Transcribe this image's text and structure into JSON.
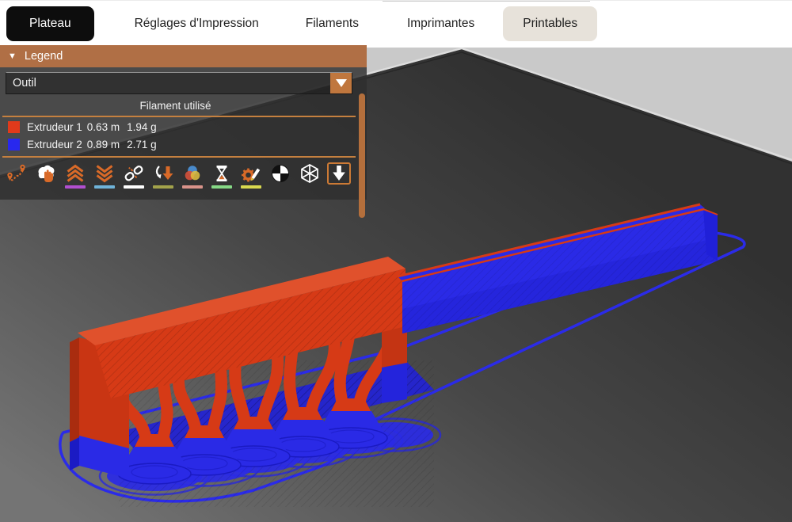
{
  "tabs": {
    "items": [
      {
        "label": "Plateau",
        "state": "active"
      },
      {
        "label": "Réglages d'Impression",
        "state": "normal"
      },
      {
        "label": "Filaments",
        "state": "normal"
      },
      {
        "label": "Imprimantes",
        "state": "normal"
      },
      {
        "label": "Printables",
        "state": "highlighted"
      }
    ]
  },
  "legend": {
    "title": "Legend",
    "collapse_glyph": "▼",
    "view_selector": {
      "value": "Outil"
    },
    "section_header": "Filament utilisé",
    "extruders": [
      {
        "name": "Extrudeur 1",
        "length": "0.63 m",
        "weight": "1.94 g",
        "swatch": "#e13a1b"
      },
      {
        "name": "Extrudeur 2",
        "length": "0.89 m",
        "weight": "2.71 g",
        "swatch": "#2828ee"
      }
    ],
    "toolbar": [
      {
        "name": "travel-paths",
        "underline": null,
        "selected": false
      },
      {
        "name": "wipe",
        "underline": null,
        "selected": false
      },
      {
        "name": "retractions",
        "underline": "#b14fd0",
        "selected": false
      },
      {
        "name": "deretractions",
        "underline": "#6fb3d9",
        "selected": false
      },
      {
        "name": "seams",
        "underline": "#ffffff",
        "selected": false
      },
      {
        "name": "tool-changes",
        "underline": "#a3a34b",
        "selected": false
      },
      {
        "name": "color-changes",
        "underline": "#d9938a",
        "selected": false
      },
      {
        "name": "pause-prints",
        "underline": "#86d986",
        "selected": false
      },
      {
        "name": "custom-gcodes",
        "underline": "#d9d94f",
        "selected": false
      },
      {
        "name": "center-of-gravity",
        "underline": null,
        "selected": false
      },
      {
        "name": "shells",
        "underline": null,
        "selected": false
      },
      {
        "name": "tool-marker",
        "underline": null,
        "selected": true
      }
    ]
  },
  "viewport": {
    "colors": {
      "background": "#c9c9c9",
      "bed_dark": "#313131",
      "bed_light": "#747474",
      "extruder1": "#d63a16",
      "extruder1_top": "#e0512c",
      "extruder1_dark": "#a92c0f",
      "extruder2": "#2a2ae6",
      "extruder2_dark": "#1b1bc4",
      "accent_orange": "#b06f45"
    }
  }
}
